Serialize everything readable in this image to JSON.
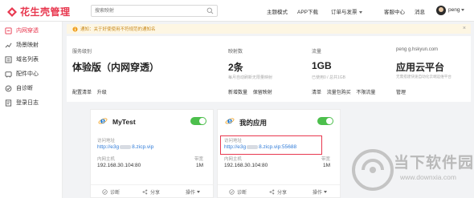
{
  "brand": {
    "name": "花生壳管理",
    "accent": "#e8384f"
  },
  "search": {
    "placeholder": "搜索映射"
  },
  "topnav": {
    "items": [
      {
        "label": "主题模式",
        "has_caret": false
      },
      {
        "label": "APP下载",
        "has_caret": false
      },
      {
        "label": "订单与发票",
        "has_caret": true
      },
      {
        "label": "客服中心",
        "has_caret": false
      },
      {
        "label": "消息",
        "has_caret": false
      }
    ],
    "user": {
      "name": "peng"
    }
  },
  "sidebar": {
    "items": [
      {
        "label": "内网穿透",
        "icon": "tunnel-icon",
        "active": true
      },
      {
        "label": "场景映射",
        "icon": "scene-icon",
        "active": false
      },
      {
        "label": "域名列表",
        "icon": "domain-list-icon",
        "active": false
      },
      {
        "label": "配件中心",
        "icon": "accessory-icon",
        "active": false
      },
      {
        "label": "自诊断",
        "icon": "diagnose-icon",
        "active": false
      },
      {
        "label": "登录日志",
        "icon": "log-icon",
        "active": false
      }
    ]
  },
  "notice": {
    "text": "通知：关于好使使用不符规范的通知名",
    "close": "×"
  },
  "summary": {
    "columns": [
      {
        "label": "服务级别",
        "value": "体验版（内网穿透）",
        "sub": "",
        "actions": [
          "配置清单",
          "升级"
        ]
      },
      {
        "label": "映射数",
        "value": "2条",
        "sub": "每月自动刷新无限量映射",
        "actions": [
          "新增数量",
          "保留映射"
        ]
      },
      {
        "label": "流量",
        "value": "1GB",
        "sub": "已使用0 / 总共1GB",
        "actions": [
          "清单",
          "流量包购买",
          "不限流量"
        ]
      },
      {
        "label": "peng          g.hskyun.com",
        "value": "应用云平台",
        "sub": "无需搭建快速自动化云端运维平台",
        "actions": [
          "管理"
        ]
      }
    ]
  },
  "cards": [
    {
      "title": "MyTest",
      "access_label": "访问地址",
      "access_url_prefix": "http://e3g",
      "access_url_suffix": "8.zicp.vip",
      "host_label": "内网主机",
      "host": "192.168.30.104:80",
      "bw_label": "带宽",
      "bw_value": "1M",
      "foot": {
        "diagnose": "诊断",
        "share": "分享",
        "ops": "操作"
      },
      "enabled": true,
      "highlighted": false
    },
    {
      "title": "我的应用",
      "access_label": "访问地址",
      "access_url_prefix": "http://e3g",
      "access_url_suffix": "8.zicp.vip:55688",
      "host_label": "内网主机",
      "host": "192.168.30.104:80",
      "bw_label": "带宽",
      "bw_value": "1M",
      "foot": {
        "diagnose": "诊断",
        "share": "分享",
        "ops": "操作"
      },
      "enabled": true,
      "highlighted": true
    }
  ],
  "watermark": {
    "title": "当下软件园",
    "url": "www.downxia.com"
  }
}
